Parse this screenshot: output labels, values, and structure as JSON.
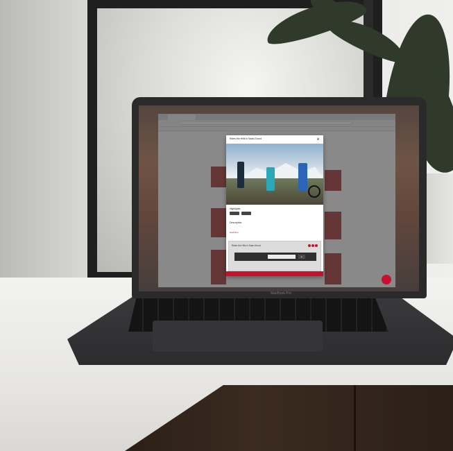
{
  "scene": {
    "laptop_brand": "MacBook Pro"
  },
  "browser": {
    "tab_title": "",
    "url": ""
  },
  "modal": {
    "title": "Rides the Hills in Saas-Grund",
    "close_icon": "close-icon",
    "highlights_label": "Highlights",
    "description_label": "Description",
    "description_text": "",
    "more_link": "Read More",
    "embed_title": "Rides the Hills in Saas-Grund",
    "cta_label": ""
  },
  "colors": {
    "accent": "#c8102e",
    "modal_bg": "#ffffff",
    "overlay": "rgba(40,40,40,0.55)"
  }
}
